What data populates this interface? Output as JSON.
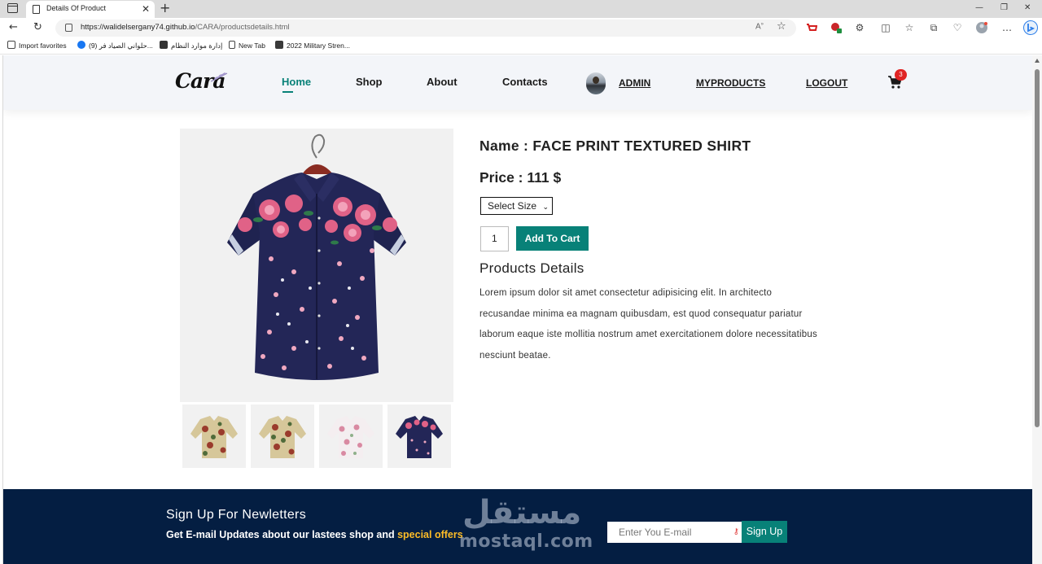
{
  "browser": {
    "tab_title": "Details Of Product",
    "tab_close": "✕",
    "new_tab": "+",
    "url_host": "https://walidelsergany74.github.io",
    "url_path": "/CARA/productsdetails.html",
    "read_aloud": "A̲",
    "window_controls": {
      "minimize": "—",
      "restore": "❐",
      "close": "✕"
    },
    "bookmarks": [
      {
        "label": "Import favorites",
        "icon": "import-icon"
      },
      {
        "label": "(9) حلواني الصياد فر...",
        "icon": "facebook-icon"
      },
      {
        "label": "إدارة موارد النظام",
        "icon": "bird-icon"
      },
      {
        "label": "New Tab",
        "icon": "page-icon"
      },
      {
        "label": "2022 Military Stren...",
        "icon": "site-icon"
      }
    ]
  },
  "header": {
    "logo": "Cara",
    "nav": [
      {
        "label": "Home",
        "active": true
      },
      {
        "label": "Shop"
      },
      {
        "label": "About"
      },
      {
        "label": "Contacts"
      }
    ],
    "admin": "ADMIN",
    "myproducts": "MYPRODUCTS",
    "logout": "LOGOUT",
    "cart_count": "3"
  },
  "product": {
    "name": "Name : FACE PRINT TEXTURED SHIRT",
    "price": "Price : 111 $",
    "size_select": "Select Size",
    "quantity": "1",
    "add_to_cart": "Add To Cart",
    "details_title": "Products Details",
    "details_text": "Lorem ipsum dolor sit amet consectetur adipisicing elit. In architecto recusandae minima ea magnam quibusdam, est quod consequatur pariatur laborum eaque iste mollitia nostrum amet exercitationem dolore necessitatibus nesciunt beatae.",
    "thumbnails": [
      "floral-beige-shirt",
      "floral-beige-shirt",
      "floral-white-shirt",
      "floral-navy-shirt"
    ]
  },
  "newsletter": {
    "title": "Sign Up For Newletters",
    "subtitle_main": "Get E-mail Updates about our lastees shop and ",
    "subtitle_highlight": "special offers",
    "email_placeholder": "Enter You E-mail",
    "signup": "Sign Up"
  },
  "watermark": {
    "arabic": "مستقل",
    "latin": "mostaql.com"
  },
  "colors": {
    "accent": "#088178",
    "footer_bg": "#041e42",
    "highlight": "#ffbd27",
    "badge": "#e02424"
  }
}
